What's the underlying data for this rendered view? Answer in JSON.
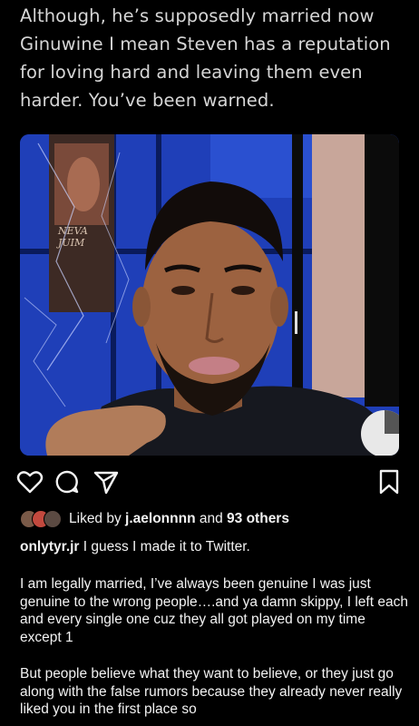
{
  "tweet": {
    "text": "Although, he’s supposedly married now Ginuwine I mean Steven has a reputation for loving hard and leaving them even harder. You’ve been warned."
  },
  "post": {
    "image": {
      "poster_text": "NEVA\nJUIM"
    },
    "actions": {
      "like_icon": "heart-icon",
      "comment_icon": "comment-icon",
      "share_icon": "send-icon",
      "save_icon": "bookmark-icon"
    },
    "likes": {
      "prefix": "Liked by",
      "user": "j.aelonnnn",
      "middle": "and",
      "others": "93 others"
    },
    "caption": {
      "username": "onlytyr.jr",
      "text": "I guess I made it to Twitter."
    },
    "paragraphs": [
      "I am legally married, I’ve always been genuine I was just genuine to the wrong people….and ya damn skippy, I left each and every single one cuz they all got played on my time except 1",
      "But people believe what they want to believe, or they just go along with the false rumors because they already never really liked you in the first place so"
    ]
  },
  "colors": {
    "background": "#000000",
    "text": "#f2f2f2",
    "tweet_text": "#d6d6d6"
  }
}
